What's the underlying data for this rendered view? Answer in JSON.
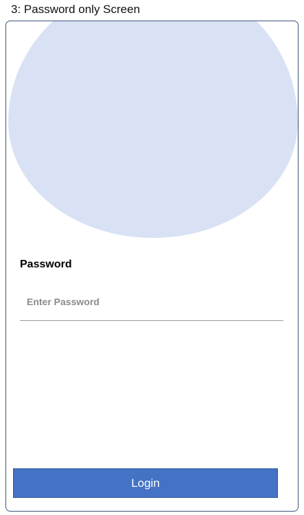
{
  "screen": {
    "title": "3: Password only Screen"
  },
  "form": {
    "password_label": "Password",
    "password_placeholder": "Enter Password",
    "password_value": ""
  },
  "actions": {
    "login_label": "Login"
  },
  "colors": {
    "accent": "#4472c4",
    "decor_blob": "#d9e2f4",
    "frame_border": "#3b5378"
  }
}
